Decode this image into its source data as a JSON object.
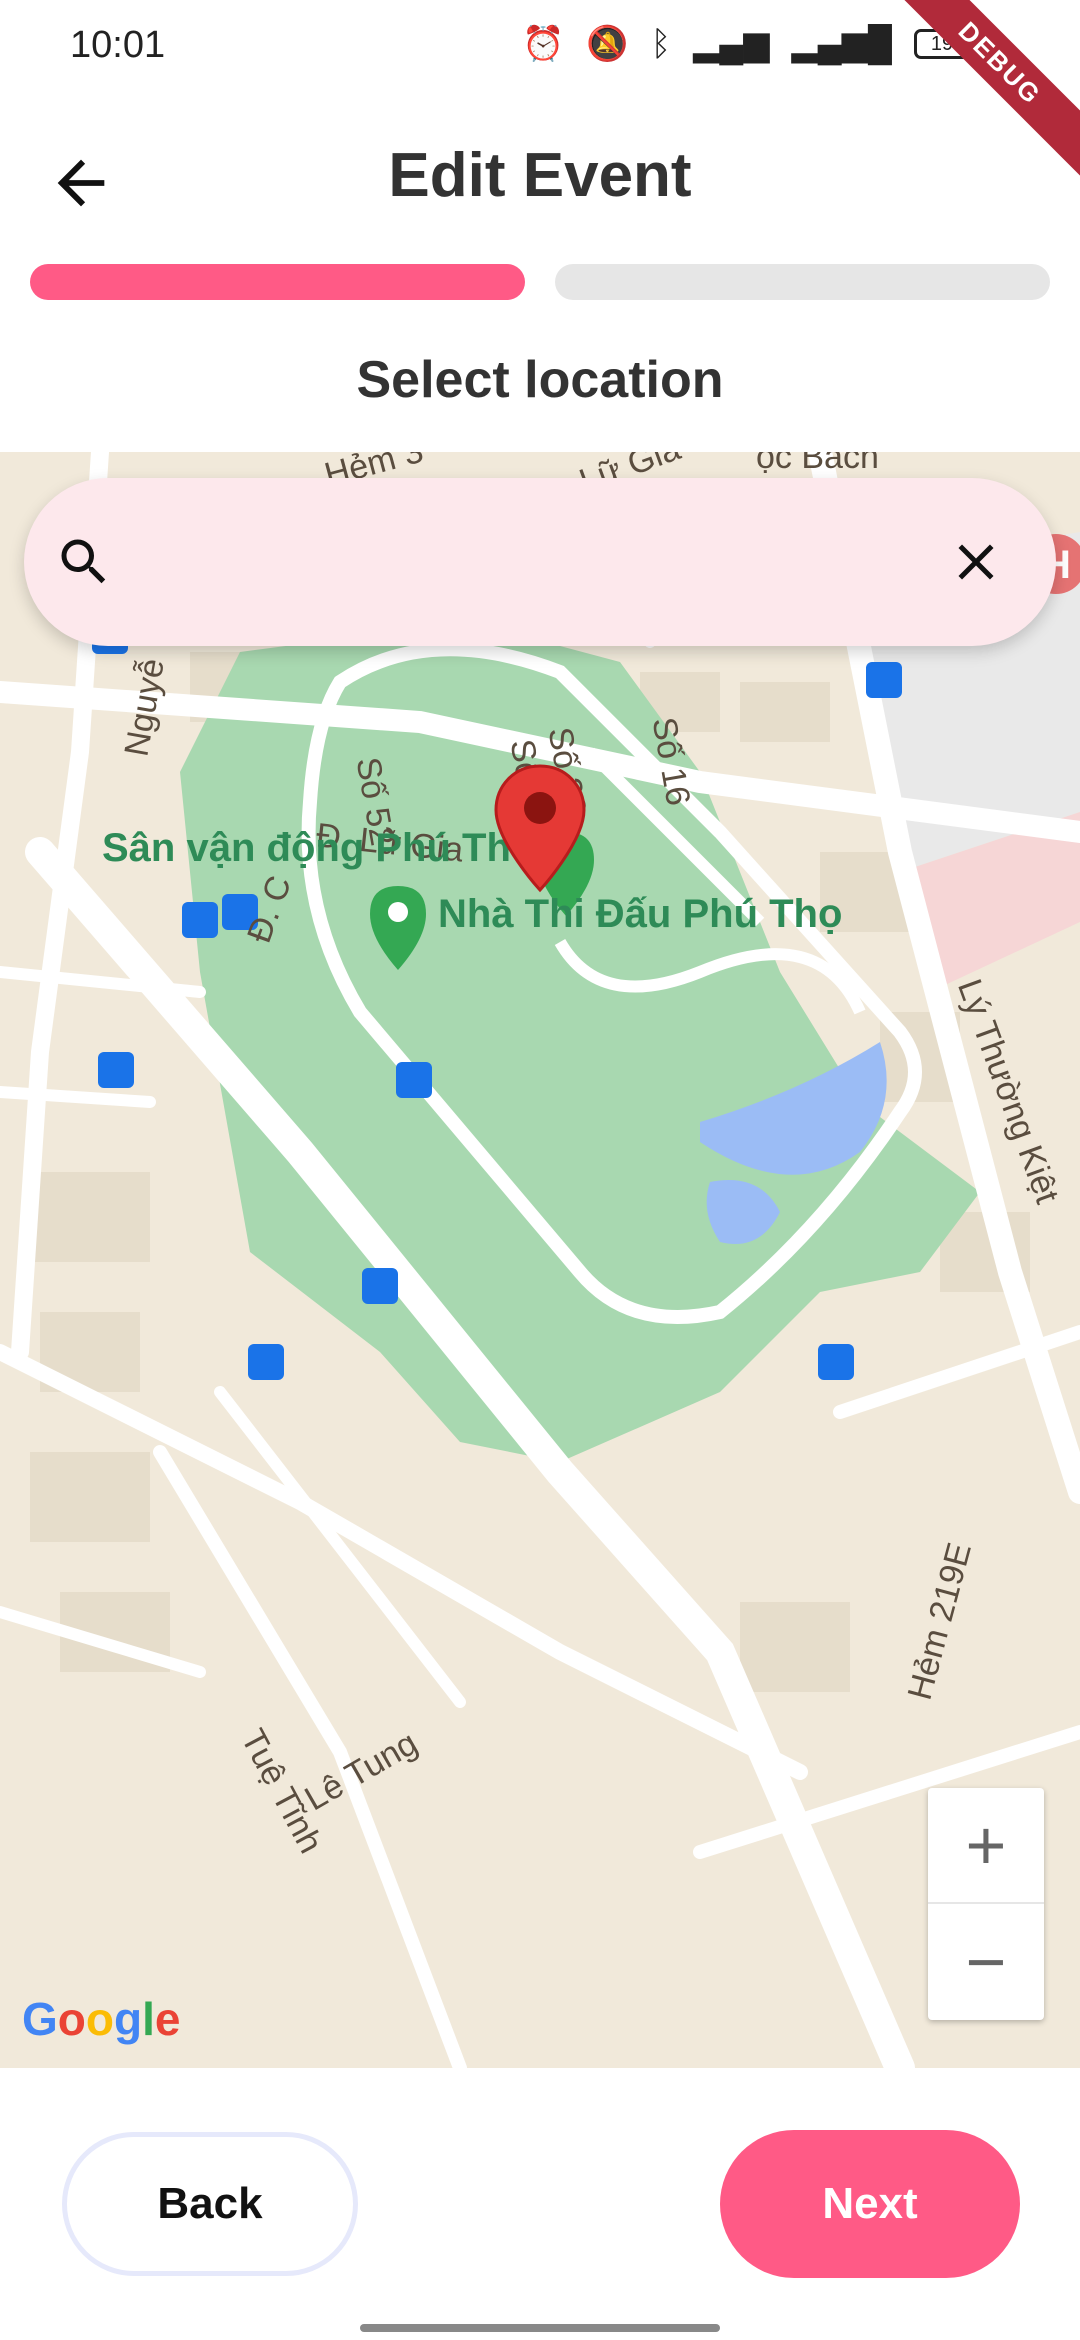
{
  "status_bar": {
    "time": "10:01",
    "battery": "19",
    "debug_label": "DEBUG"
  },
  "header": {
    "title": "Edit Event",
    "back_icon": "arrow-left-icon"
  },
  "progress": {
    "total_steps": 2,
    "current_step": 1
  },
  "section": {
    "title": "Select location"
  },
  "search": {
    "value": "",
    "placeholder": "",
    "search_icon": "search-icon",
    "clear_icon": "close-icon"
  },
  "map": {
    "street_labels": [
      "Nguyễ",
      "Số 52",
      "Số 34",
      "Số 28",
      "Số 16",
      "Đ. Lữ Gia",
      "Đ. C",
      "Lý Thường Kiệt",
      "Hẻm 219E",
      "Tuệ Tĩnh",
      "Lê Tung",
      "Hẻm 3",
      "Lữ Gia",
      "ọc Bách"
    ],
    "poi_labels": [
      "Sân vận động Phú Thọ",
      "Nhà Thi Đấu Phú Thọ"
    ],
    "zoom_in_label": "+",
    "zoom_out_label": "−",
    "attribution": [
      "G",
      "o",
      "o",
      "g",
      "l",
      "e"
    ],
    "colors": {
      "land": "#f1e9da",
      "park": "#a8d8b0",
      "road": "#ffffff",
      "water": "#9bbcf5",
      "pin": "#e53935",
      "bus_stop": "#1a73e8"
    }
  },
  "footer": {
    "back_label": "Back",
    "next_label": "Next"
  },
  "colors": {
    "accent": "#ff5a86",
    "search_bg": "#fde8ec"
  }
}
